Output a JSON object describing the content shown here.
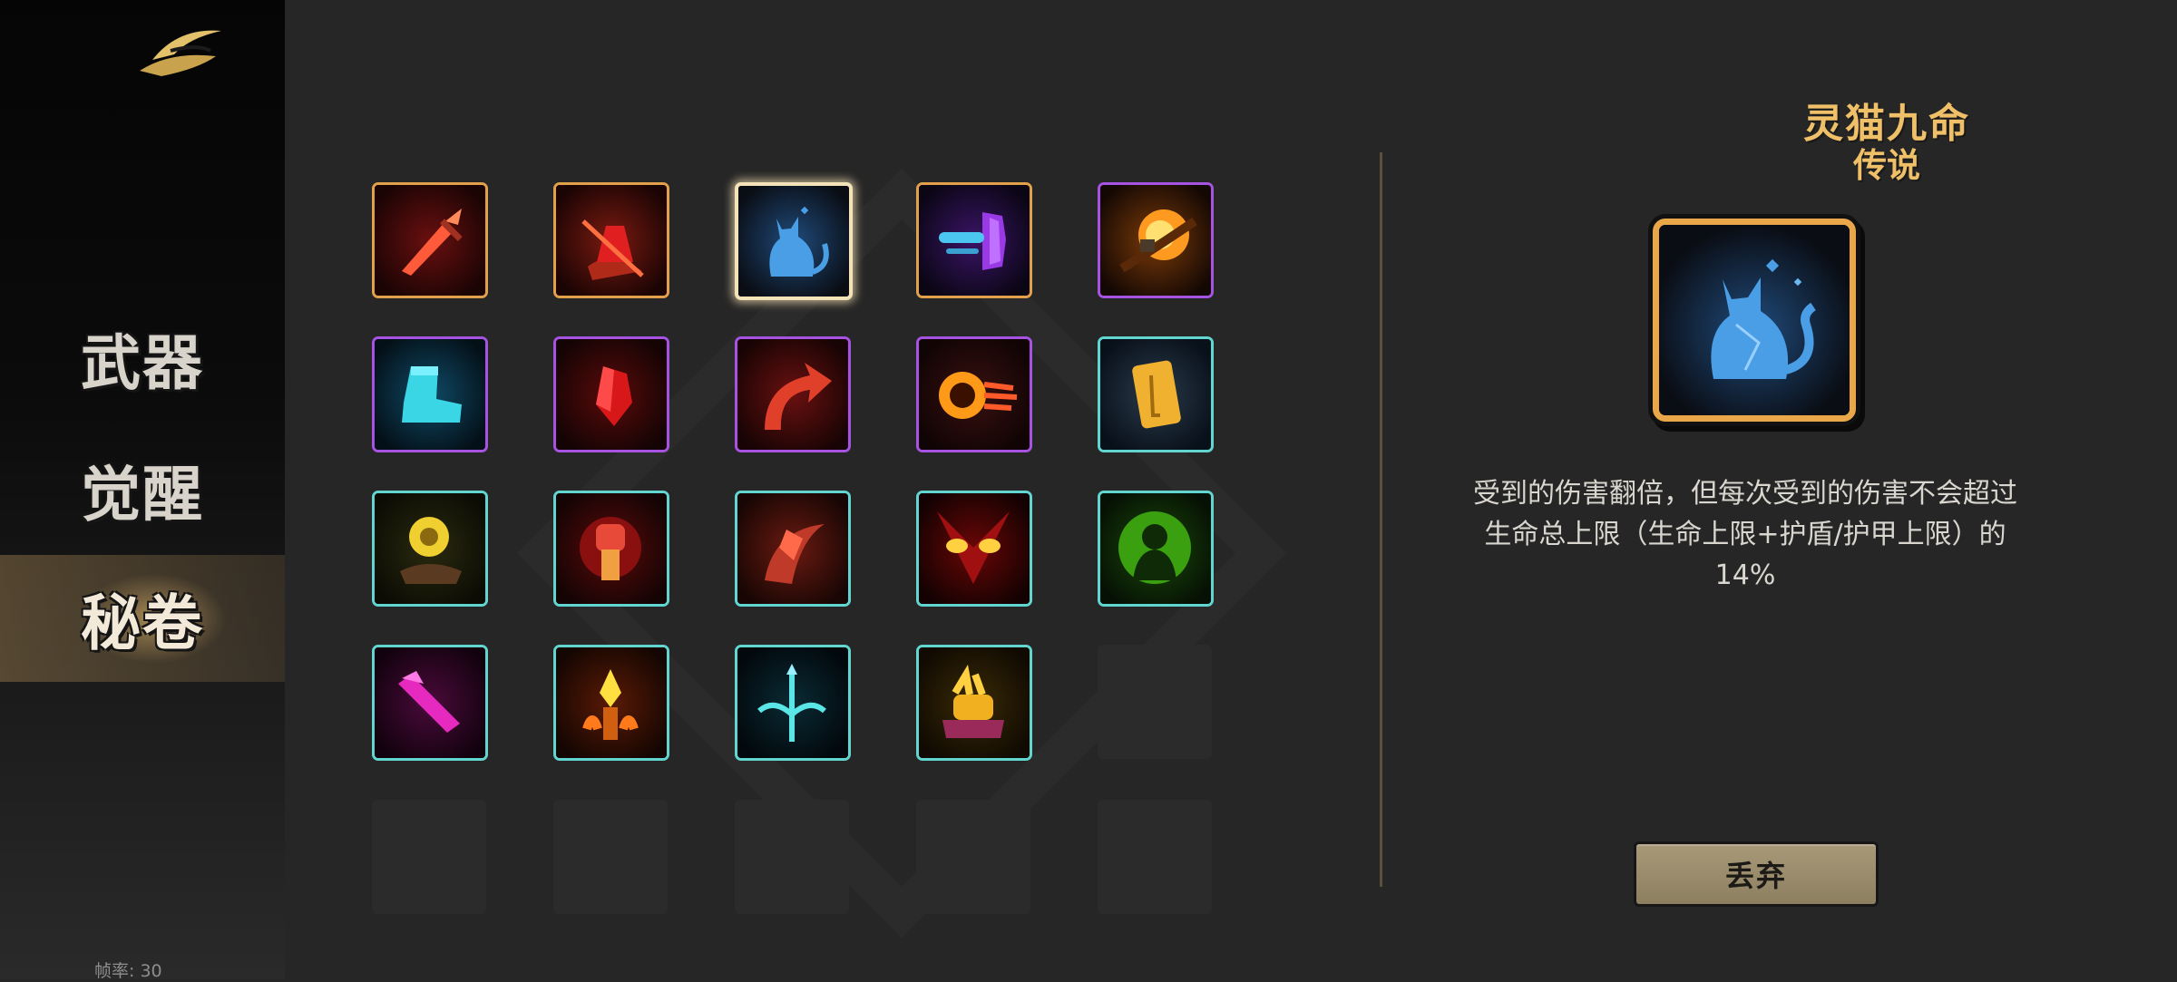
{
  "sidebar": {
    "nav": [
      {
        "label": "武器"
      },
      {
        "label": "觉醒"
      },
      {
        "label": "秘卷",
        "selected": true
      }
    ],
    "fps_label": "帧率: 30"
  },
  "inventory": {
    "grid": [
      [
        "sword-icon",
        "broken-flask-icon",
        "crystal-cat-icon",
        "dash-blade-icon",
        "explosion-icon"
      ],
      [
        "boot-icon",
        "red-gem-icon",
        "return-arrow-icon",
        "fire-orb-icon",
        "scroll-icon"
      ],
      [
        "golden-rune-icon",
        "fist-icon",
        "crystal-slash-icon",
        "demon-eyes-icon",
        "green-spirit-icon"
      ],
      [
        "magenta-blade-icon",
        "flame-crystal-icon",
        "trident-icon",
        "gold-rabbit-icon",
        null
      ],
      [
        null,
        null,
        null,
        null,
        null
      ]
    ],
    "rarity": [
      [
        "orange",
        "orange",
        "orange",
        "orange",
        "purple"
      ],
      [
        "purple",
        "purple",
        "purple",
        "purple",
        "teal"
      ],
      [
        "teal",
        "teal",
        "teal",
        "teal",
        "teal"
      ],
      [
        "teal",
        "teal",
        "teal",
        "teal",
        null
      ],
      [
        null,
        null,
        null,
        null,
        null
      ]
    ],
    "selected": [
      0,
      2
    ]
  },
  "detail": {
    "title": "灵猫九命",
    "rarity": "传说",
    "icon": "crystal-cat-icon",
    "description": "受到的伤害翻倍，但每次受到的伤害不会超过生命总上限（生命上限+护盾/护甲上限）的14%",
    "discard_label": "丢弃"
  },
  "colors": {
    "legendary_border": "#e3a04b",
    "epic_border": "#a653e4",
    "rare_border": "#61d6d1",
    "title_gold": "#f0c068"
  }
}
